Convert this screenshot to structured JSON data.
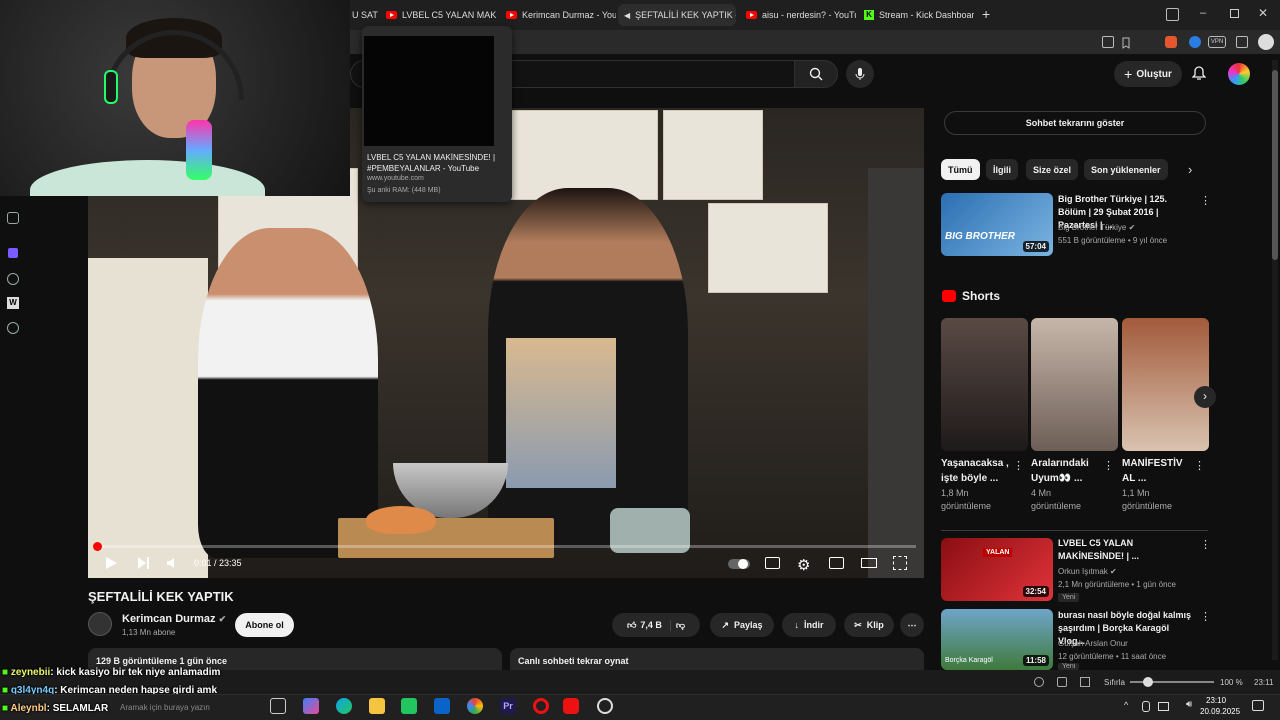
{
  "browser": {
    "tabs": [
      {
        "label": "U SAT",
        "icon": "none"
      },
      {
        "label": "LVBEL C5 YALAN MAKİNES",
        "icon": "youtube-icon"
      },
      {
        "label": "Kerimcan Durmaz - YouTub",
        "icon": "youtube-icon"
      },
      {
        "label": "ŞEFTALİLİ KEK YAPTIK - You",
        "icon": "speaker-icon"
      },
      {
        "label": "aisu - nerdesin? - YouTube",
        "icon": "youtube-icon"
      },
      {
        "label": "Stream - Kick Dashboard",
        "icon": "kick-icon"
      }
    ],
    "new_tab": "+",
    "tab_preview": {
      "title": "LVBEL C5 YALAN MAKİNESİNDE! | #PEMBEYALANLAR - YouTube",
      "url": "www.youtube.com",
      "memory": "Şu anki RAM: (448 MB)"
    }
  },
  "youtube": {
    "create_label": "Oluştur",
    "video": {
      "title": "ŞEFTALİLİ KEK YAPTIK",
      "time": "0:01 / 23:35",
      "progress": 0.001
    },
    "channel": {
      "name": "Kerimcan Durmaz",
      "subs": "1,13 Mn abone",
      "subscribe": "Abone ol"
    },
    "actions": {
      "likes": "7,4 B",
      "share": "Paylaş",
      "download": "İndir",
      "clip": "Klip"
    },
    "description": "129 B görüntüleme  1 gün önce",
    "chat_replay": "Canlı sohbeti tekrar oynat",
    "show_chat": "Sohbet tekrarını göster",
    "chips": [
      "Tümü",
      "İlgili",
      "Size özel",
      "Son yüklenenler"
    ],
    "related": [
      {
        "title": "Big Brother Türkiye | 125. Bölüm | 29 Şubat 2016 | Pazartesi | ...",
        "channel": "Big Brother Türkiye",
        "meta": "551 B görüntüleme • 9 yıl önce",
        "duration": "57:04",
        "thumb_text": "BIG BROTHER"
      },
      {
        "title": "LVBEL C5 YALAN MAKİNESİNDE! | ...",
        "channel": "Orkun Işıtmak",
        "meta": "2,1 Mn görüntüleme • 1 gün önce",
        "duration": "32:54",
        "badge": "Yeni",
        "thumb_text": "YALAN"
      },
      {
        "title": "burası nasıl böyle doğal kalmış şaşırdım | Borçka Karagöl Vlog...",
        "channel": "Gülşah Arslan Onur",
        "meta": "12 görüntüleme • 11 saat önce",
        "duration": "11:58",
        "badge": "Yeni",
        "thumb_text": "Borçka Karagöl"
      }
    ],
    "shorts_title": "Shorts",
    "shorts": [
      {
        "title": "Yaşanacaksa , işte böyle ...",
        "views": "1,8 Mn görüntüleme"
      },
      {
        "title": "Aralarındaki Uyum👀 ...",
        "views": "4 Mn görüntüleme"
      },
      {
        "title": "MANİFESTİV AL ...",
        "views": "1,1 Mn görüntüleme"
      }
    ]
  },
  "chat_overlay": [
    {
      "user": "zeynebii",
      "message": ": kick kasiyo bir tek niye anlamadim"
    },
    {
      "user": "q3l4yn4q",
      "message": ": Kerimcan neden hapse girdi amk"
    },
    {
      "user": "Aleynbl",
      "message": ": SELAMLAR"
    }
  ],
  "statusbar": {
    "reset": "Sıfırla",
    "zoom": "100 %",
    "time": "23:11"
  },
  "taskbar": {
    "time": "23:10",
    "date": "20.09.2025",
    "search_placeholder": "Aramak için buraya yazın"
  },
  "colors": {
    "yt_red": "#ff0000",
    "kick_green": "#53fc18",
    "bg": "#0f0f0f"
  }
}
